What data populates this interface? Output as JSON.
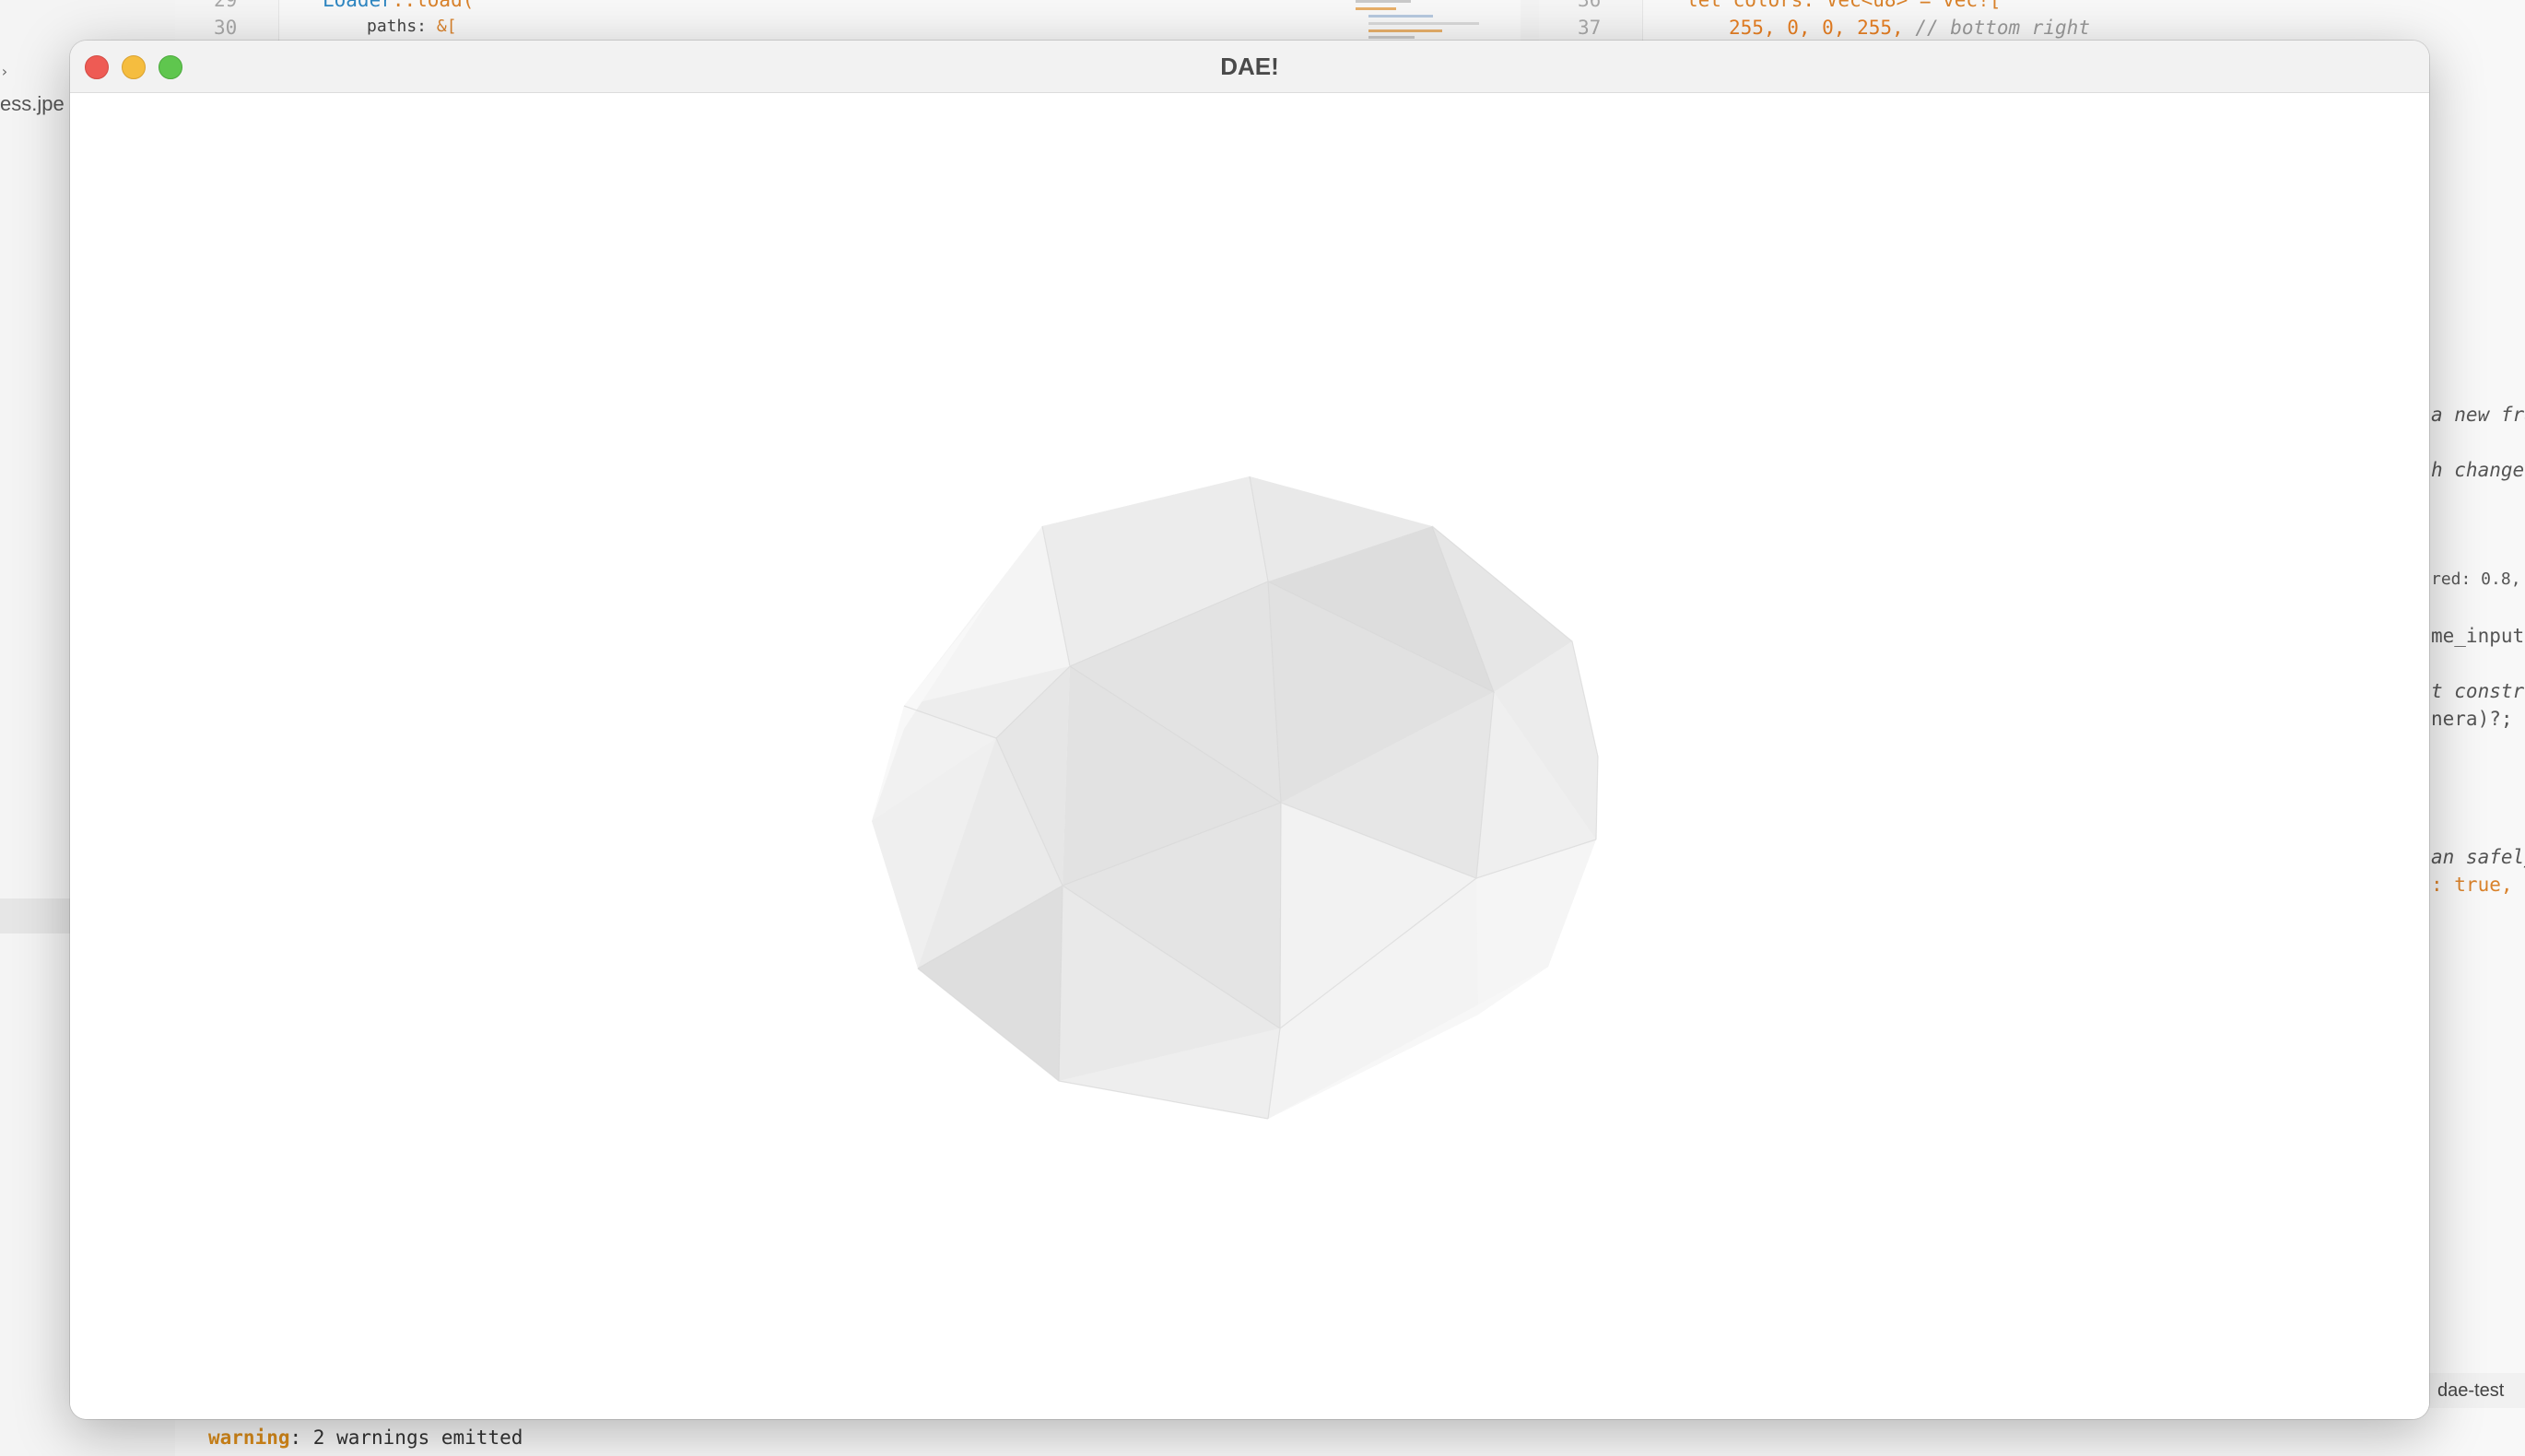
{
  "window": {
    "title": "DAE!"
  },
  "editor": {
    "sidebar_file": "ess.jpe",
    "left_pane": {
      "lines": [
        {
          "number": "29",
          "code_fn": "Loader",
          "code_rest": "::load("
        },
        {
          "number": "30",
          "code_key": "paths:",
          "code_rest": " &["
        }
      ]
    },
    "right_pane": {
      "lines": [
        {
          "number": "36",
          "code": "let colors: Vec<u8> = vec!["
        },
        {
          "number": "37",
          "code_nums": "255, 0, 0, 255,",
          "code_comment": "// bottom right"
        }
      ]
    },
    "right_edge_fragments": [
      "a new fra",
      "h changes",
      "red: 0.8,",
      "me_input.",
      "t constru",
      "nera)?;",
      "an safely",
      ": true, ."
    ],
    "tab_label": "dae-test",
    "console": {
      "warning_word": "warning",
      "warning_rest": ": 2 warnings emitted"
    }
  },
  "scene": {
    "object": "low-poly icosphere",
    "background_color": "#ffffff"
  }
}
